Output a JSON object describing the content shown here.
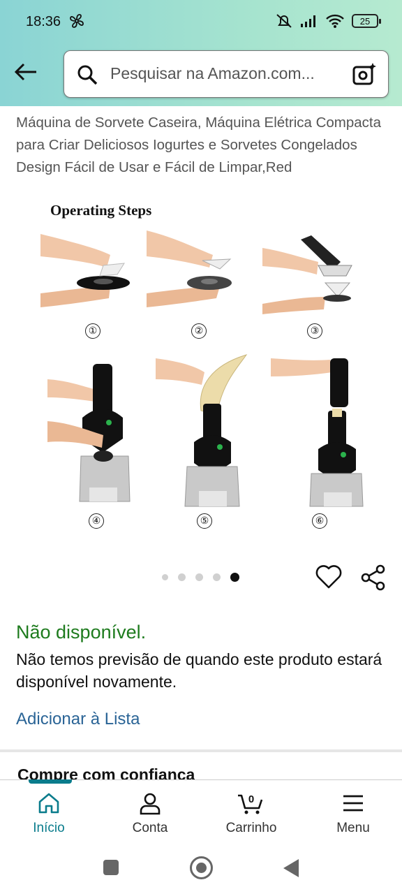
{
  "status_bar": {
    "time": "18:36",
    "battery": "25"
  },
  "search": {
    "placeholder": "Pesquisar na Amazon.com..."
  },
  "product": {
    "title": "Máquina de Sorvete Caseira, Máquina Elétrica Compacta para Criar Deliciosos Iogurtes e Sorvetes Congelados Design Fácil de Usar e Fácil de Limpar,Red",
    "image_header": "Operating Steps",
    "step_numbers": [
      "①",
      "②",
      "③",
      "④",
      "⑤",
      "⑥"
    ],
    "carousel": {
      "count": 5,
      "active_index": 4
    }
  },
  "availability": {
    "status": "Não disponível.",
    "message": "Não temos previsão de quando este produto estará disponível novamente.",
    "add_to_list": "Adicionar à Lista"
  },
  "section_peek": "Compre com confiança",
  "tabs": [
    {
      "label": "Início",
      "icon": "home-icon",
      "active": true
    },
    {
      "label": "Conta",
      "icon": "person-icon",
      "active": false
    },
    {
      "label": "Carrinho",
      "icon": "cart-icon",
      "active": false,
      "badge": "0"
    },
    {
      "label": "Menu",
      "icon": "menu-icon",
      "active": false
    }
  ],
  "colors": {
    "header_gradient_start": "#8ad4d4",
    "header_gradient_end": "#b6ead0",
    "available_green": "#1e7b1e",
    "link_blue": "#2a6496",
    "tab_active": "#0a7c8c"
  }
}
